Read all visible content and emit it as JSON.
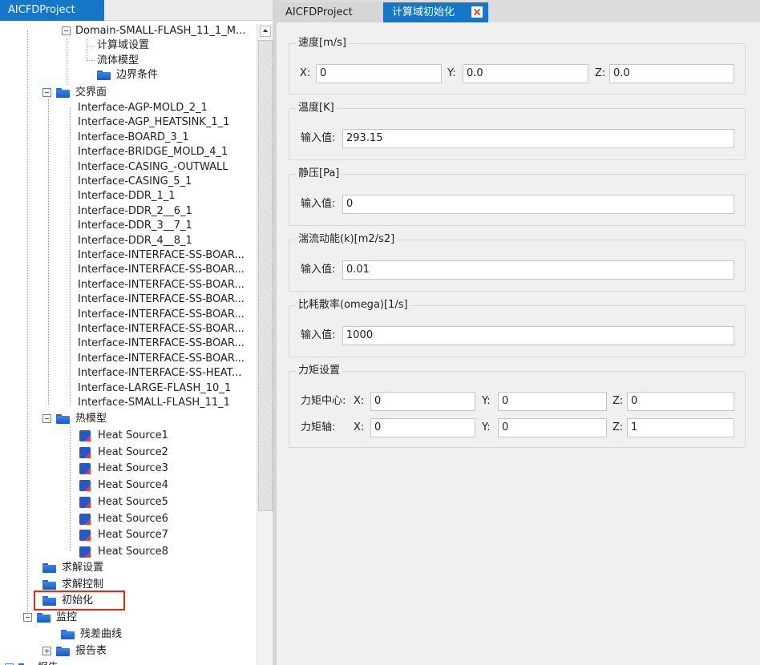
{
  "left_tab": {
    "title": "AICFDProject"
  },
  "tree": {
    "domain_label": "Domain-SMALL-FLASH_11_1_M...",
    "domain_children": [
      "计算域设置",
      "流体模型",
      "边界条件"
    ],
    "interface_label": "交界面",
    "interfaces": [
      "Interface-AGP-MOLD_2_1",
      "Interface-AGP_HEATSINK_1_1",
      "Interface-BOARD_3_1",
      "Interface-BRIDGE_MOLD_4_1",
      "Interface-CASING_-OUTWALL",
      "Interface-CASING_5_1",
      "Interface-DDR_1_1",
      "Interface-DDR_2__6_1",
      "Interface-DDR_3__7_1",
      "Interface-DDR_4__8_1",
      "Interface-INTERFACE-SS-BOAR...",
      "Interface-INTERFACE-SS-BOAR...",
      "Interface-INTERFACE-SS-BOAR...",
      "Interface-INTERFACE-SS-BOAR...",
      "Interface-INTERFACE-SS-BOAR...",
      "Interface-INTERFACE-SS-BOAR...",
      "Interface-INTERFACE-SS-BOAR...",
      "Interface-INTERFACE-SS-BOAR...",
      "Interface-INTERFACE-SS-HEAT...",
      "Interface-LARGE-FLASH_10_1",
      "Interface-SMALL-FLASH_11_1"
    ],
    "thermal_label": "热模型",
    "heat_sources": [
      "Heat Source1",
      "Heat Source2",
      "Heat Source3",
      "Heat Source4",
      "Heat Source5",
      "Heat Source6",
      "Heat Source7",
      "Heat Source8"
    ],
    "solve_settings": "求解设置",
    "solve_control": "求解控制",
    "init": "初始化",
    "monitor": "监控",
    "residual": "残差曲线",
    "report": "报告表",
    "bottom_partial": "报告"
  },
  "right_tabs": {
    "tab1": "AICFDProject",
    "tab2": "计算域初始化"
  },
  "form": {
    "velocity": {
      "title": "速度[m/s]",
      "x_label": "X:",
      "y_label": "Y:",
      "z_label": "Z:",
      "x": "0",
      "y": "0.0",
      "z": "0.0"
    },
    "temperature": {
      "title": "温度[K]",
      "label": "输入值:",
      "value": "293.15"
    },
    "pressure": {
      "title": "静压[Pa]",
      "label": "输入值:",
      "value": "0"
    },
    "tke": {
      "title": "湍流动能(k)[m2/s2]",
      "label": "输入值:",
      "value": "0.01"
    },
    "omega": {
      "title": "比耗散率(omega)[1/s]",
      "label": "输入值:",
      "value": "1000"
    },
    "torque": {
      "title": "力矩设置",
      "center_label": "力矩中心:",
      "axis_label": "力矩轴:",
      "x_label": "X:",
      "y_label": "Y:",
      "z_label": "Z:",
      "center": {
        "x": "0",
        "y": "0",
        "z": "0"
      },
      "axis": {
        "x": "0",
        "y": "0",
        "z": "1"
      }
    }
  },
  "colors": {
    "accent": "#1677c9",
    "highlight": "#e12c1c",
    "panel_bg": "#f0f0f0"
  }
}
